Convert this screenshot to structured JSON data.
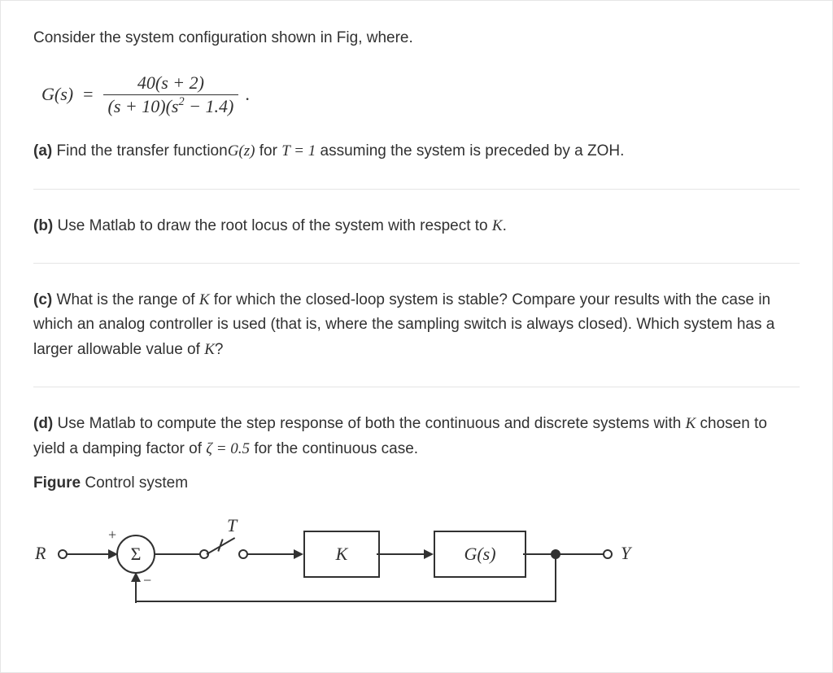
{
  "intro": "Consider the system configuration shown in Fig, where.",
  "equation": {
    "lhs": "G(s)",
    "numerator": "40(s + 2)",
    "denominator": "(s + 10)(s² − 1.4)",
    "trailing": "."
  },
  "parts": {
    "a": {
      "label": "(a)",
      "before": " Find the transfer function",
      "func": "G(z)",
      "mid": " for ",
      "cond": "T = 1",
      "after": " assuming the system is preceded by a ZOH."
    },
    "b": {
      "label": "(b)",
      "before": " Use Matlab to draw the root locus of the system with respect to ",
      "var": "K",
      "after": "."
    },
    "c": {
      "label": "(c)",
      "l1a": " What is the range of ",
      "var": "K",
      "l1b": " for which the closed-loop system is stable? Compare your results with the case in which an analog controller is used (that is, where the sampling switch is always closed). Which system has a larger allowable value of ",
      "var2": "K",
      "l1c": "?"
    },
    "d": {
      "label": "(d)",
      "l1a": " Use Matlab to compute the step response of both the continuous and discrete systems with ",
      "var": "K",
      "l1b": " chosen to yield a damping factor of ",
      "zeta": "ζ = 0.5",
      "l1c": " for the continuous case."
    }
  },
  "figure": {
    "label_bold": "Figure",
    "label_rest": " Control system",
    "R": "R",
    "Sigma": "Σ",
    "plus": "+",
    "minus": "−",
    "T": "T",
    "K": "K",
    "Gs": "G(s)",
    "Y": "Y"
  }
}
